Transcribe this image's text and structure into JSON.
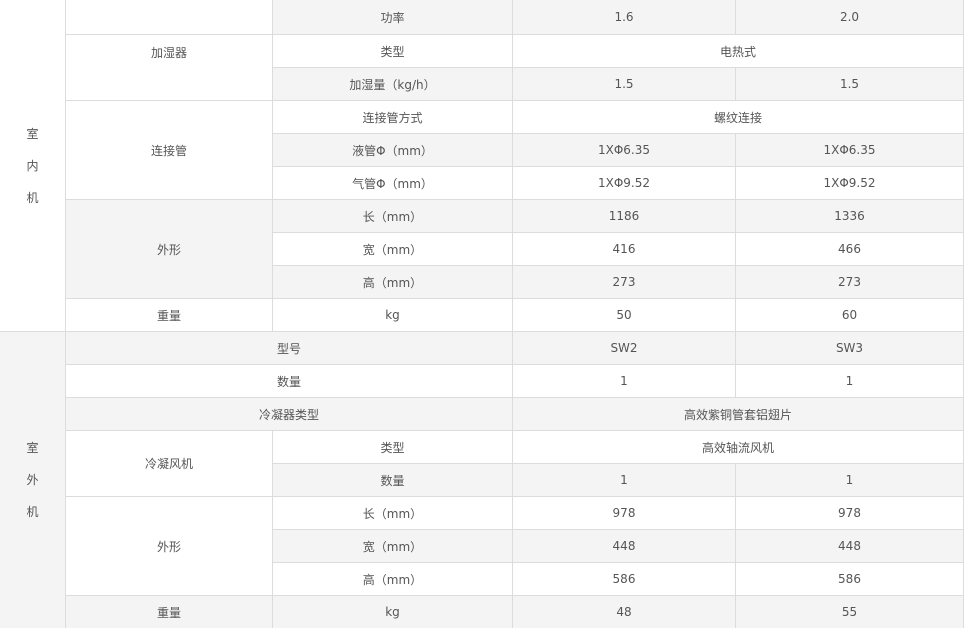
{
  "indoor": {
    "section_label": [
      "室",
      "内",
      "机"
    ],
    "power": {
      "label": "功率",
      "v1": "1.6",
      "v2": "2.0"
    },
    "humidifier": {
      "label": "加湿器",
      "type": {
        "label": "类型",
        "value": "电热式"
      },
      "amount": {
        "label": "加湿量（kg/h）",
        "v1": "1.5",
        "v2": "1.5"
      }
    },
    "pipe": {
      "label": "连接管",
      "method": {
        "label": "连接管方式",
        "value": "螺纹连接"
      },
      "liquid": {
        "label": "液管Φ（mm）",
        "v1": "1XΦ6.35",
        "v2": "1XΦ6.35"
      },
      "gas": {
        "label": "气管Φ（mm）",
        "v1": "1XΦ9.52",
        "v2": "1XΦ9.52"
      }
    },
    "shape": {
      "label": "外形",
      "length": {
        "label": "长（mm）",
        "v1": "1186",
        "v2": "1336"
      },
      "width": {
        "label": "宽（mm）",
        "v1": "416",
        "v2": "466"
      },
      "height": {
        "label": "高（mm）",
        "v1": "273",
        "v2": "273"
      }
    },
    "weight": {
      "label": "重量",
      "unit": "kg",
      "v1": "50",
      "v2": "60"
    }
  },
  "outdoor": {
    "section_label": [
      "室",
      "外",
      "机"
    ],
    "model": {
      "label": "型号",
      "v1": "SW2",
      "v2": "SW3"
    },
    "qty": {
      "label": "数量",
      "v1": "1",
      "v2": "1"
    },
    "condenser": {
      "label": "冷凝器类型",
      "value": "高效紫铜管套铝翅片"
    },
    "fan": {
      "label": "冷凝风机",
      "type": {
        "label": "类型",
        "value": "高效轴流风机"
      },
      "qty": {
        "label": "数量",
        "v1": "1",
        "v2": "1"
      }
    },
    "shape": {
      "label": "外形",
      "length": {
        "label": "长（mm）",
        "v1": "978",
        "v2": "978"
      },
      "width": {
        "label": "宽（mm）",
        "v1": "448",
        "v2": "448"
      },
      "height": {
        "label": "高（mm）",
        "v1": "586",
        "v2": "586"
      }
    },
    "weight": {
      "label": "重量",
      "unit": "kg",
      "v1": "48",
      "v2": "55"
    }
  }
}
